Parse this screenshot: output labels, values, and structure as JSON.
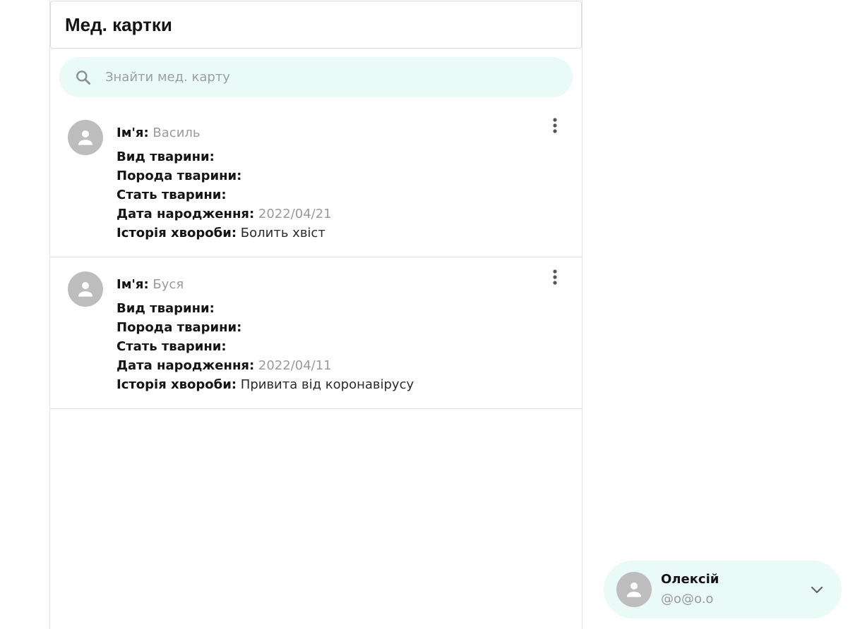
{
  "header": {
    "title": "Мед. картки"
  },
  "search": {
    "placeholder": "Знайти мед. карту",
    "icon": "search-icon"
  },
  "labels": {
    "name": "Ім'я:",
    "species": "Вид тварини:",
    "breed": "Порода тварини:",
    "sex": "Стать тварини:",
    "birth_date": "Дата народження:",
    "history": "Історія хвороби:"
  },
  "cards": [
    {
      "name": "Василь",
      "species": "",
      "breed": "",
      "sex": "",
      "birth_date": "2022/04/21",
      "history": "Болить хвіст"
    },
    {
      "name": "Буся",
      "species": "",
      "breed": "",
      "sex": "",
      "birth_date": "2022/04/11",
      "history": "Привита від коронавірусу"
    }
  ],
  "user": {
    "name": "Олексій",
    "handle": "@o@o.o"
  },
  "colors": {
    "accent_bg": "#eafaf7",
    "avatar": "#bdbdbd"
  }
}
